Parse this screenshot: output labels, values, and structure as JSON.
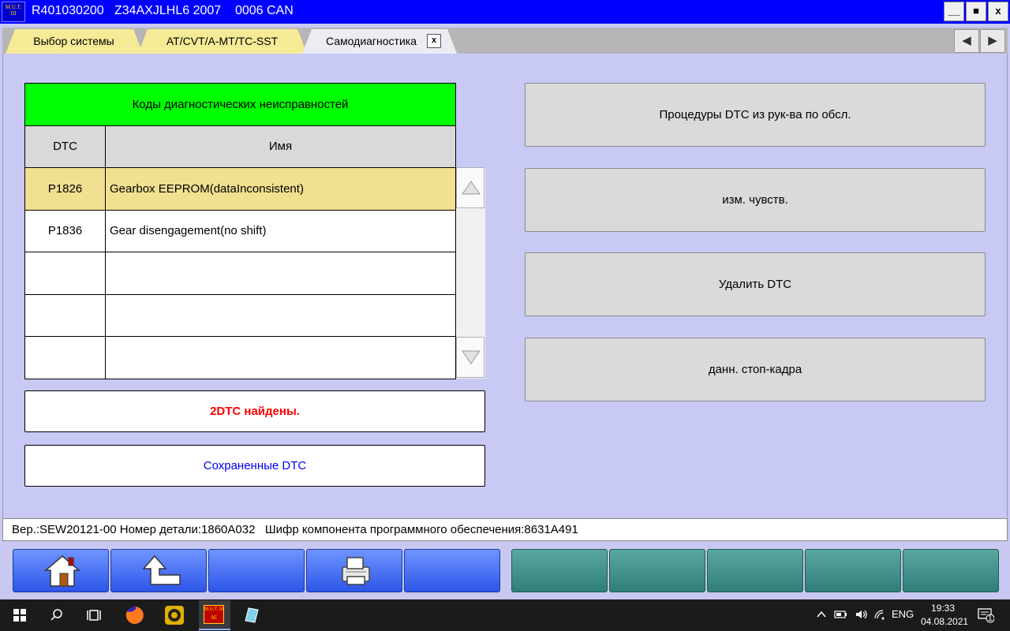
{
  "window": {
    "title": "R401030200   Z34AXJLHL6 2007    0006 CAN",
    "logo_text": "M.U.T. III",
    "minimize_label": "__",
    "maximize_label": "■",
    "close_label": "x"
  },
  "tabs": [
    {
      "label": "Выбор системы"
    },
    {
      "label": "AT/CVT/A-MT/TC-SST"
    },
    {
      "label": "Самодиагностика",
      "close": "x"
    }
  ],
  "nav": {
    "prev": "◀",
    "next": "▶"
  },
  "dtc_table": {
    "title": "Коды диагностических  неисправностей",
    "col_code": "DTC",
    "col_name": "Имя",
    "rows": [
      {
        "code": "P1826",
        "name": "Gearbox EEPROM(dataInconsistent)",
        "selected": true
      },
      {
        "code": "P1836",
        "name": "Gear disengagement(no shift)",
        "selected": false
      },
      {
        "code": "",
        "name": "",
        "selected": false
      },
      {
        "code": "",
        "name": "",
        "selected": false
      },
      {
        "code": "",
        "name": "",
        "selected": false
      }
    ]
  },
  "status": {
    "found": "2DTC найдены.",
    "saved": "Сохраненные DTC"
  },
  "actions": {
    "procedures": "Процедуры DTC из рук-ва по обсл.",
    "sensitivity": "изм. чувств.",
    "delete": "Удалить DTC",
    "freeze": "данн. стоп-кадра"
  },
  "version_bar": "Вер.:SEW20121-00 Номер детали:1860A032   Шифр компонента программного обеспечения:8631A491",
  "toolbar_icons": [
    "home-icon",
    "back-icon",
    "printer-icon"
  ],
  "colors": {
    "titlebar": "#0000ff",
    "header_green": "#00ff00",
    "selected_row": "#f0e08f",
    "found_text": "#ff0000",
    "saved_text": "#0000ee",
    "background": "#c9c9f6"
  },
  "taskbar": {
    "lang": "ENG",
    "time": "19:33",
    "date": "04.08.2021",
    "notifications": "1",
    "app_label": "M.U.T. III SE"
  }
}
